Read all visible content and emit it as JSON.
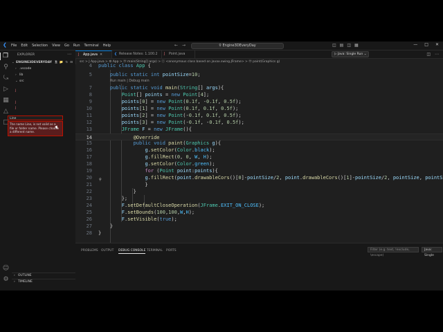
{
  "titlebar": {
    "menus": [
      "File",
      "Edit",
      "Selection",
      "View",
      "Go",
      "Run",
      "Terminal",
      "Help"
    ],
    "search": "Engine3DEveryDay"
  },
  "sidebar": {
    "header": "EXPLORER",
    "project": "ENGINE3DEVERYDAY",
    "items": [
      ".vscode",
      "lib",
      "src"
    ],
    "rename_value": "Line",
    "error_message": "The name Line, is not valid as a file or folder name. Please choose a different name.",
    "outline": "OUTLINE",
    "timeline": "TIMELINE"
  },
  "tabs": [
    {
      "label": "App.java",
      "active": true
    },
    {
      "label": "Release Notes: 1.100.2",
      "active": false
    },
    {
      "label": "Point.java",
      "active": false
    }
  ],
  "run_button": "Java: Single Run",
  "breadcrumb": "src > J App.java > ⚙ App > ⓜ main(String[] args) > ⓒ <anonymous class based on javax.swing.JFrame> > ⓜ paint(Graphics g)",
  "editor": {
    "codelens": "Run main | Debug main",
    "current_line": 14
  },
  "panel": {
    "tabs": [
      "PROBLEMS",
      "OUTPUT",
      "DEBUG CONSOLE",
      "TERMINAL",
      "PORTS"
    ],
    "active_tab": "DEBUG CONSOLE",
    "filter_placeholder": "Filter (e.g. text, !exclude, \\escape)",
    "java_select": "Java: Single"
  },
  "colors": {
    "accent": "#0078d4",
    "error_border": "#be1100",
    "error_bg": "#5a1d1d"
  }
}
